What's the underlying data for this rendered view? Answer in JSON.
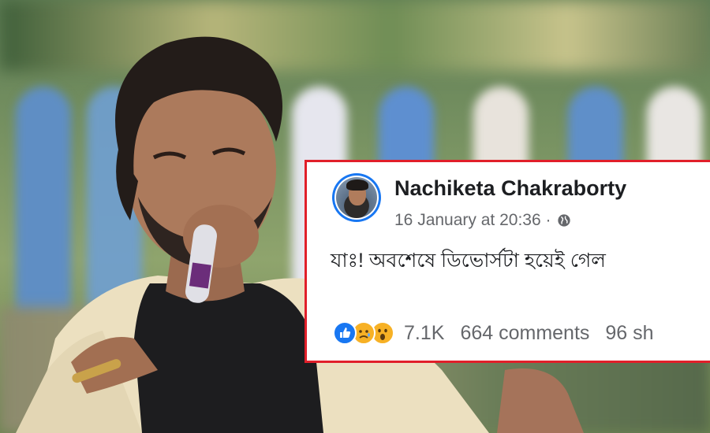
{
  "post": {
    "author_name": "Nachiketa Chakraborty",
    "timestamp": "16 January at 20:36 ·",
    "privacy_icon": "globe-icon",
    "text": "যাঃ! অবশেষে ডিভোর্সটা হয়েই গেল",
    "reactions": {
      "icons": [
        "like-icon",
        "sad-icon",
        "wow-icon"
      ],
      "count": "7.1K"
    },
    "comments": "664 comments",
    "shares": "96 sh"
  },
  "colors": {
    "card_border": "#e11f2a",
    "facebook_blue": "#1877f2",
    "meta_gray": "#65676b",
    "text_dark": "#1c1e21"
  }
}
